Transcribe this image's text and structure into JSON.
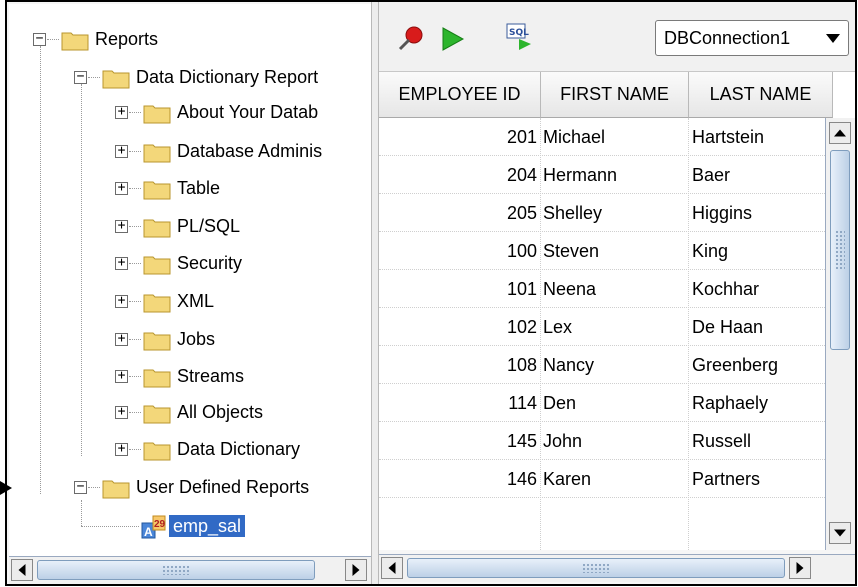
{
  "tree": {
    "root": {
      "label": "Reports",
      "expanded": true
    },
    "data_dictionary_reports": {
      "label": "Data Dictionary Report",
      "expanded": true
    },
    "dd_items": [
      {
        "label": "About Your Datab"
      },
      {
        "label": "Database Adminis"
      },
      {
        "label": "Table"
      },
      {
        "label": "PL/SQL"
      },
      {
        "label": "Security"
      },
      {
        "label": "XML"
      },
      {
        "label": "Jobs"
      },
      {
        "label": "Streams"
      },
      {
        "label": "All Objects"
      },
      {
        "label": "Data Dictionary"
      }
    ],
    "user_defined_reports": {
      "label": "User Defined Reports",
      "expanded": true
    },
    "selected_report": {
      "label": "emp_sal"
    },
    "toggle_expanded": "−",
    "toggle_collapsed": "+"
  },
  "toolbar": {
    "pin_icon": "pushpin-icon",
    "run_icon": "play-icon",
    "sql_icon": "run-sql-icon",
    "sql_icon_text": "SQL",
    "connection": "DBConnection1"
  },
  "grid": {
    "columns": [
      "EMPLOYEE ID",
      "FIRST NAME",
      "LAST NAME"
    ],
    "rows": [
      [
        "201",
        "Michael",
        "Hartstein"
      ],
      [
        "204",
        "Hermann",
        "Baer"
      ],
      [
        "205",
        "Shelley",
        "Higgins"
      ],
      [
        "100",
        "Steven",
        "King"
      ],
      [
        "101",
        "Neena",
        "Kochhar"
      ],
      [
        "102",
        "Lex",
        "De Haan"
      ],
      [
        "108",
        "Nancy",
        "Greenberg"
      ],
      [
        "114",
        "Den",
        "Raphaely"
      ],
      [
        "145",
        "John",
        "Russell"
      ],
      [
        "146",
        "Karen",
        "Partners"
      ]
    ]
  },
  "colors": {
    "folder": "#f3d77a",
    "selection": "#316ac5",
    "run_green": "#2db52d",
    "pin_red": "#d81b1b"
  }
}
